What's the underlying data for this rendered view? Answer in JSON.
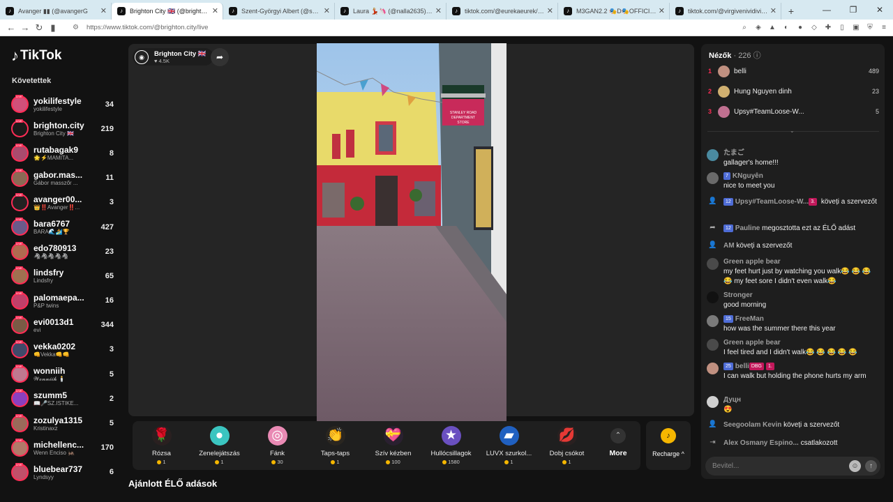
{
  "browser": {
    "tabs": [
      {
        "label": "Avanger ▮▮ (@avangerG",
        "active": false
      },
      {
        "label": "Brighton City 🇬🇧 (@brighton.cit",
        "active": true
      },
      {
        "label": "Szent-Györgyi Albert (@szentgya1",
        "active": false
      },
      {
        "label": "Laura 💃🏼🦄 (@nalla2635) ÉLŐ a",
        "active": false
      },
      {
        "label": "tiktok.com/@eurekaeurek/live",
        "active": false
      },
      {
        "label": "M3GAN2.2 🎭D🎭OFFICIAL (@",
        "active": false
      },
      {
        "label": "tiktok.com/@virgivenividivici/live",
        "active": false
      }
    ],
    "url": "https://www.tiktok.com/@brighton.city/live"
  },
  "sidebar": {
    "logo": "TikTok",
    "following_title": "Követettek",
    "items": [
      {
        "name": "yokilifestyle",
        "sub": "yokilifestyle",
        "count": "34",
        "color": "#d0507a"
      },
      {
        "name": "brighton.city",
        "sub": "Brighton City 🇬🇧",
        "count": "219",
        "color": "#1a1a1a"
      },
      {
        "name": "rutabagak9",
        "sub": "🌟⚡MAMITA...",
        "count": "8",
        "color": "#a94b6e"
      },
      {
        "name": "gabor.mas...",
        "sub": "Gábor masszőr ...",
        "count": "11",
        "color": "#8a6a55"
      },
      {
        "name": "avanger00...",
        "sub": "👑‼️Avanger‼️...",
        "count": "3",
        "color": "#222222"
      },
      {
        "name": "bara6767",
        "sub": "BARA🌊🏄🏆",
        "count": "427",
        "color": "#6a5a8a"
      },
      {
        "name": "edo780913",
        "sub": "🦓🦓🦓🦓🦓",
        "count": "23",
        "color": "#b06a50"
      },
      {
        "name": "lindsfry",
        "sub": "Lindsfry",
        "count": "65",
        "color": "#a07050"
      },
      {
        "name": "palomaepa...",
        "sub": "P&P twins",
        "count": "16",
        "color": "#c0406a"
      },
      {
        "name": "evi0013d1",
        "sub": "evi",
        "count": "344",
        "color": "#7a5a45"
      },
      {
        "name": "vekka0202",
        "sub": "👊Vekka👊👊",
        "count": "3",
        "color": "#404a6a"
      },
      {
        "name": "wonniih",
        "sub": "𝓦𝓸𝓷𝓷𝓲𝓲𝓱 🕯️",
        "count": "5",
        "color": "#c07890"
      },
      {
        "name": "szumm5",
        "sub": "📖🎤SZ.ISTIKE...",
        "count": "2",
        "color": "#8a40c0"
      },
      {
        "name": "zozulya1315",
        "sub": "Kristinaxz",
        "count": "5",
        "color": "#9a6a5a"
      },
      {
        "name": "michellenc...",
        "sub": "Wenn Enciso 🦗",
        "count": "170",
        "color": "#b07a6a"
      },
      {
        "name": "bluebear737",
        "sub": "Lyndsyy",
        "count": "6",
        "color": "#c0506a"
      }
    ]
  },
  "stream": {
    "host_name": "Brighton City 🇬🇧",
    "host_likes": "♥ 4.5K",
    "gifts": [
      {
        "name": "Rózsa",
        "price": "1",
        "icon": "🌹",
        "bg": "#2a2020"
      },
      {
        "name": "Zenelejátszás",
        "price": "1",
        "icon": "●",
        "bg": "#3bc5c0"
      },
      {
        "name": "Fánk",
        "price": "30",
        "icon": "◎",
        "bg": "#e98ab4"
      },
      {
        "name": "Taps-taps",
        "price": "1",
        "icon": "👏",
        "bg": "#2a2620"
      },
      {
        "name": "Szív kézben",
        "price": "100",
        "icon": "💝",
        "bg": "#2a2030"
      },
      {
        "name": "Hullócsillagok",
        "price": "1580",
        "icon": "★",
        "bg": "#6a50c0"
      },
      {
        "name": "LUVX szurkol...",
        "price": "1",
        "icon": "▰",
        "bg": "#2060c0"
      },
      {
        "name": "Dobj csókot",
        "price": "1",
        "icon": "💋",
        "bg": "#2a2020"
      }
    ],
    "more_label": "More",
    "recharge_label": "Recharge ^",
    "recommended_title": "Ajánlott ÉLŐ adások"
  },
  "chat": {
    "viewers_title": "Nézők",
    "viewers_count": "· 226 ⓘ",
    "top_viewers": [
      {
        "rank": "1",
        "name": "belli",
        "score": "489",
        "color": "#c09080"
      },
      {
        "rank": "2",
        "name": "Hung Nguyen dinh",
        "score": "23",
        "color": "#d0b070"
      },
      {
        "rank": "3",
        "name": "Upsy#TeamLoose-W...",
        "score": "5",
        "color": "#c07090"
      }
    ],
    "messages": [
      {
        "user": "たまご",
        "text": "gallager's home!!!",
        "av": "#4a8aa0"
      },
      {
        "user": "KNguyên",
        "text": "nice to meet you",
        "badge": "7",
        "av": "#6a6a6a"
      },
      {
        "user": "Upsy#TeamLoose-W...",
        "text": "köveți a szervezőt",
        "badge": "12",
        "badge2": "3.",
        "icon": "👤"
      },
      {
        "user": "Pauline",
        "text": "megosztotta ezt az ÉLŐ adást",
        "badge": "12",
        "icon": "➦"
      },
      {
        "user": "AM",
        "text": "köveți a szervezőt",
        "icon": "👤"
      },
      {
        "user": "Green apple bear",
        "text": "my feet hurt just by watching you walk😂 😂 😂 😂 my feet sore I didn't even walk😂",
        "av": "#4a4a4a"
      },
      {
        "user": "Stronger",
        "text": "good morning",
        "av": "#111111"
      },
      {
        "user": "FreeMan",
        "text": "how was the summer there this year",
        "badge": "15",
        "av": "#7a7a7a"
      },
      {
        "user": "Green apple bear",
        "text": "I feel tired and I didn't walk😂 😂 😂 😂 😂",
        "av": "#4a4a4a"
      },
      {
        "user": "belli",
        "text": "I can walk but holding the phone hurts my arm",
        "badge": "25",
        "badge2": "DBG",
        "badge3": "1.",
        "av": "#c09080"
      },
      {
        "user": "Дуцн",
        "text": "😍",
        "av": "#d0d0d0"
      },
      {
        "user": "Seegoolam Kevin",
        "text": "köveți a szervezőt",
        "icon": "👤"
      },
      {
        "user": "Alex Osmany Espino...",
        "text": "csatlakozott",
        "icon": "⇥"
      }
    ],
    "input_placeholder": "Bevitel..."
  }
}
